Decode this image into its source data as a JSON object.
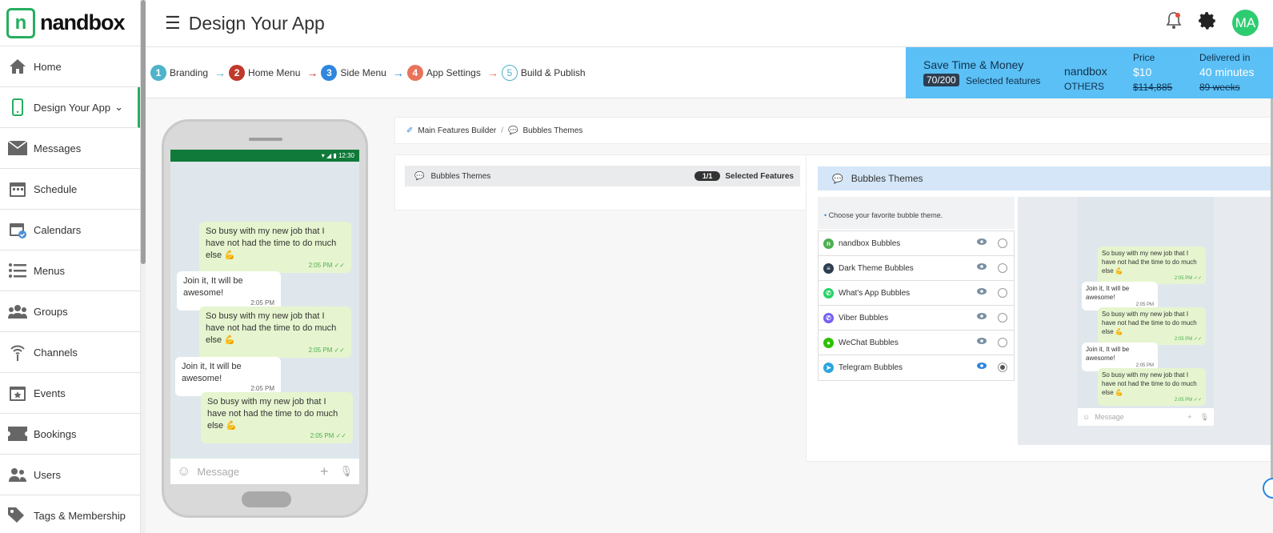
{
  "brand": {
    "name": "nandbox",
    "mark": "n"
  },
  "header": {
    "title": "Design Your App",
    "avatar_initials": "MA"
  },
  "sidebar": {
    "items": [
      {
        "label": "Home",
        "icon": "home-icon"
      },
      {
        "label": "Design Your App",
        "icon": "phone-icon",
        "active": true
      },
      {
        "label": "Messages",
        "icon": "envelope-icon"
      },
      {
        "label": "Schedule",
        "icon": "calendar-icon"
      },
      {
        "label": "Calendars",
        "icon": "calendar-check-icon"
      },
      {
        "label": "Menus",
        "icon": "list-icon"
      },
      {
        "label": "Groups",
        "icon": "users-icon"
      },
      {
        "label": "Channels",
        "icon": "broadcast-icon"
      },
      {
        "label": "Events",
        "icon": "calendar-star-icon"
      },
      {
        "label": "Bookings",
        "icon": "ticket-icon"
      },
      {
        "label": "Users",
        "icon": "user-group-icon"
      },
      {
        "label": "Tags & Membership",
        "icon": "tags-icon"
      }
    ]
  },
  "steps": [
    {
      "num": "1",
      "label": "Branding",
      "color": "#4fb3c9"
    },
    {
      "num": "2",
      "label": "Home Menu",
      "color": "#c0392b"
    },
    {
      "num": "3",
      "label": "Side Menu",
      "color": "#2e86de"
    },
    {
      "num": "4",
      "label": "App Settings",
      "color": "#e8735a"
    },
    {
      "num": "5",
      "label": "Build & Publish",
      "color": "#4fb3c9"
    }
  ],
  "promo": {
    "title": "Save Time & Money",
    "count": "70/200",
    "selected": "Selected features",
    "brand": "nandbox",
    "others": "OTHERS",
    "price_label": "Price",
    "price": "$10",
    "price_old": "$114,885",
    "delivered_label": "Delivered in",
    "delivered": "40 minutes",
    "delivered_old": "89 weeks"
  },
  "phone": {
    "time": "12:30",
    "placeholder": "Message",
    "messages": [
      {
        "text": "So busy with my new job that I have not had the time to do much else 💪",
        "time": "2:05 PM",
        "dir": "out"
      },
      {
        "text": "Join it, It will be awesome!",
        "time": "2:05 PM",
        "dir": "in"
      },
      {
        "text": "So busy with my new job that I have not had the time to do much else 💪",
        "time": "2:05 PM",
        "dir": "out"
      },
      {
        "text": "Join it, It will be awesome!",
        "time": "2:05 PM",
        "dir": "in"
      },
      {
        "text": "So busy with my new job that I have not had the time to do much else 💪",
        "time": "2:05 PM",
        "dir": "out"
      }
    ]
  },
  "breadcrumb": {
    "root": "Main Features Builder",
    "separator": "/",
    "current": "Bubbles Themes"
  },
  "feature_card": {
    "name": "Bubbles Themes",
    "badge": "1/1",
    "selected": "Selected Features"
  },
  "themes_panel": {
    "title": "Bubbles Themes",
    "hint": "Choose your favorite bubble theme.",
    "options": [
      {
        "label": "nandbox Bubbles",
        "color": "#4caf50",
        "glyph": "n",
        "checked": false
      },
      {
        "label": "Dark Theme Bubbles",
        "color": "#2c3e50",
        "glyph": "≡",
        "checked": false
      },
      {
        "label": "What's App Bubbles",
        "color": "#25d366",
        "glyph": "✆",
        "checked": false
      },
      {
        "label": "Viber Bubbles",
        "color": "#7360f2",
        "glyph": "✆",
        "checked": false
      },
      {
        "label": "WeChat Bubbles",
        "color": "#2dc100",
        "glyph": "●",
        "checked": false
      },
      {
        "label": "Telegram Bubbles",
        "color": "#2ca5e0",
        "glyph": "➤",
        "checked": true
      }
    ]
  },
  "preview_placeholder": "Message"
}
